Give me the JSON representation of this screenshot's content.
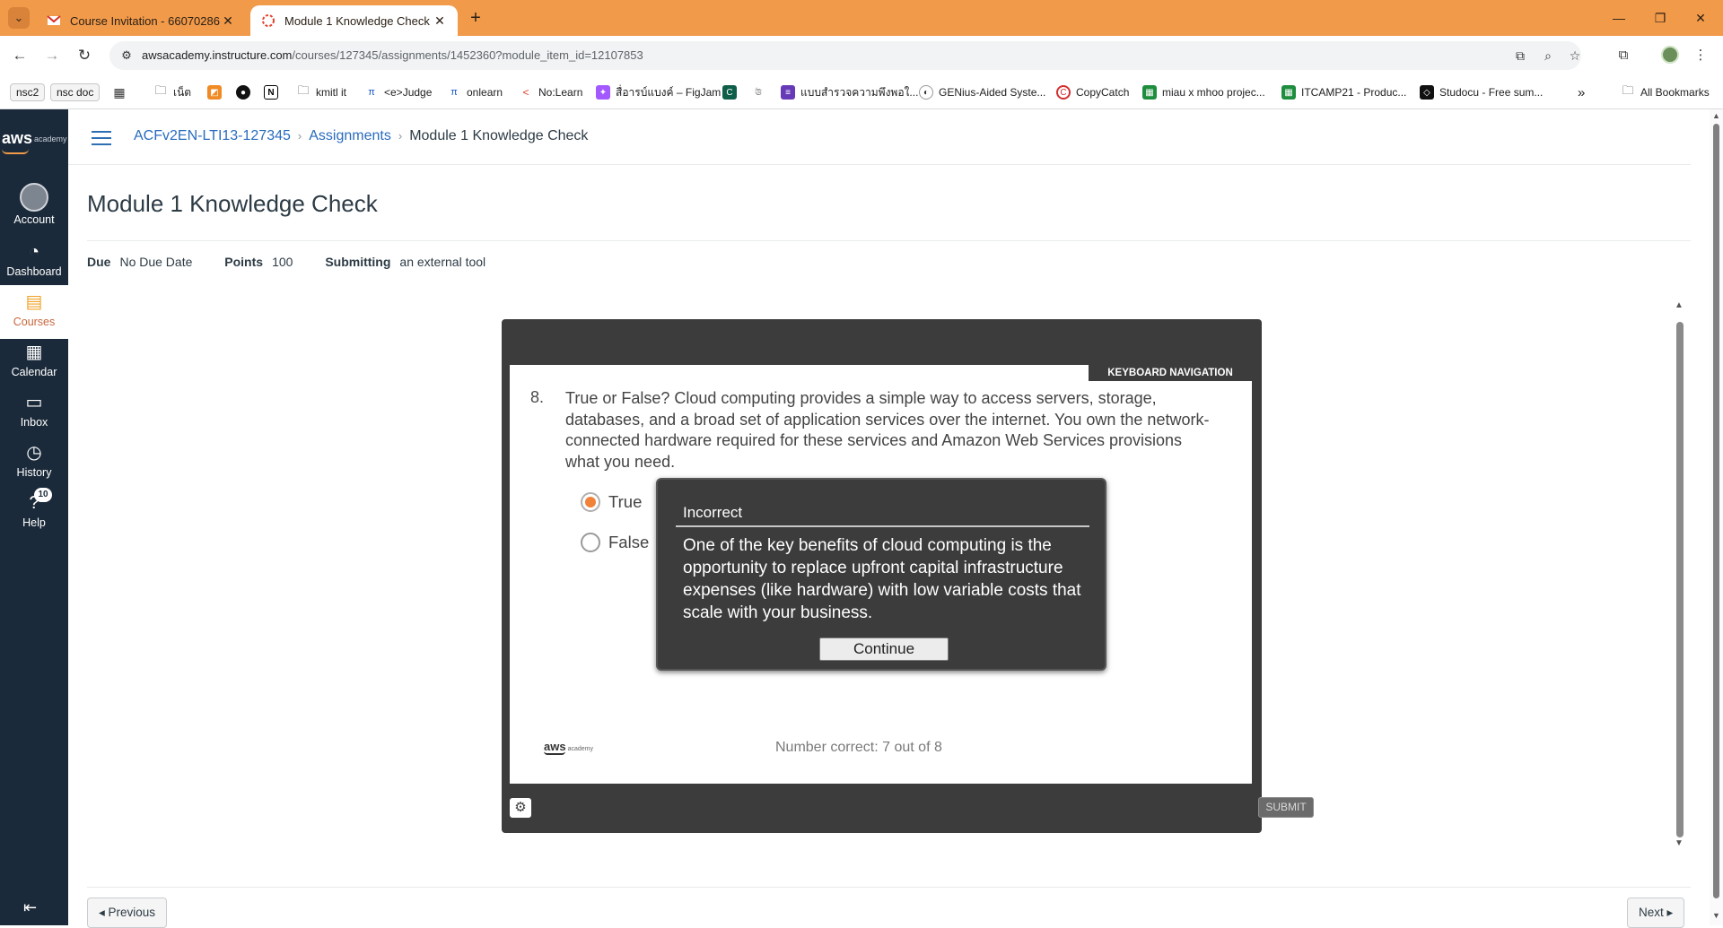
{
  "browser": {
    "tabs": [
      {
        "title": "Course Invitation - 66070286@",
        "active": false,
        "favicon": "gmail-icon"
      },
      {
        "title": "Module 1 Knowledge Check",
        "active": true,
        "favicon": "canvas-icon"
      }
    ],
    "url_host": "awsacademy.instructure.com",
    "url_path": "/courses/127345/assignments/1452360?module_item_id=12107853",
    "bookmarks": [
      {
        "label": "nsc2",
        "icon": "pill"
      },
      {
        "label": "nsc doc",
        "icon": "pill"
      },
      {
        "label": "",
        "icon": "apps-grid-icon"
      },
      {
        "label": "เน็ต",
        "icon": "folder-icon"
      },
      {
        "label": "",
        "icon": "bookmark-icon"
      },
      {
        "label": "",
        "icon": "github-icon"
      },
      {
        "label": "",
        "icon": "notion-icon"
      },
      {
        "label": "kmitl it",
        "icon": "folder-icon"
      },
      {
        "label": "<e>Judge",
        "icon": "judge-icon"
      },
      {
        "label": "onlearn",
        "icon": "onlearn-icon"
      },
      {
        "label": "No:Learn",
        "icon": "nolearn-icon"
      },
      {
        "label": "สื่อารบ์แบงค์ – FigJam",
        "icon": "figma-icon"
      },
      {
        "label": "",
        "icon": "canva-icon"
      },
      {
        "label": "",
        "icon": "site-icon"
      },
      {
        "label": "แบบสำรวจความพึงพอใ...",
        "icon": "form-icon"
      },
      {
        "label": "GENius-Aided Syste...",
        "icon": "genius-icon"
      },
      {
        "label": "CopyCatch",
        "icon": "copycatch-icon"
      },
      {
        "label": "miau x mhoo projec...",
        "icon": "sheets-icon"
      },
      {
        "label": "ITCAMP21 - Produc...",
        "icon": "sheets-icon"
      },
      {
        "label": "Studocu - Free sum...",
        "icon": "studocu-icon"
      }
    ],
    "all_bookmarks": "All Bookmarks",
    "more_bookmarks": "»"
  },
  "sidenav": {
    "logo_main": "aws",
    "logo_sub": "academy",
    "items": [
      {
        "label": "Account",
        "icon": "account-icon"
      },
      {
        "label": "Dashboard",
        "icon": "dashboard-icon"
      },
      {
        "label": "Courses",
        "icon": "courses-icon",
        "active": true
      },
      {
        "label": "Calendar",
        "icon": "calendar-icon"
      },
      {
        "label": "Inbox",
        "icon": "inbox-icon"
      },
      {
        "label": "History",
        "icon": "history-icon"
      },
      {
        "label": "Help",
        "icon": "help-icon",
        "badge": "10"
      }
    ]
  },
  "breadcrumb": {
    "course": "ACFv2EN-LTI13-127345",
    "section": "Assignments",
    "current": "Module 1 Knowledge Check"
  },
  "page": {
    "title": "Module 1 Knowledge Check",
    "due_label": "Due",
    "due_value": "No Due Date",
    "points_label": "Points",
    "points_value": "100",
    "submitting_label": "Submitting",
    "submitting_value": "an external tool"
  },
  "quiz": {
    "keyboard_nav": "KEYBOARD NAVIGATION",
    "question_number": "8.",
    "question_text": "True or False? Cloud computing provides a simple way to access servers, storage, databases, and a broad set of application services over the internet. You own the network-connected hardware required for these services and Amazon Web Services provisions what you need.",
    "options": [
      {
        "label": "True",
        "selected": true
      },
      {
        "label": "False",
        "selected": false
      }
    ],
    "feedback": {
      "title": "Incorrect",
      "text": "One of the key benefits of cloud computing is the opportunity to replace upfront capital infrastructure expenses (like hardware) with low variable costs that scale with your business.",
      "button": "Continue"
    },
    "number_correct": "Number correct: 7 out of 8",
    "logo_main": "aws",
    "logo_sub": "academy",
    "submit": "SUBMIT"
  },
  "footer": {
    "previous": "◂ Previous",
    "next": "Next ▸"
  },
  "colors": {
    "chrome": "#f19a4a",
    "sidenav": "#1b2a3a",
    "link": "#2a6bbf",
    "quiz_frame": "#3c3c3c",
    "radio_selected": "#f0823a"
  }
}
